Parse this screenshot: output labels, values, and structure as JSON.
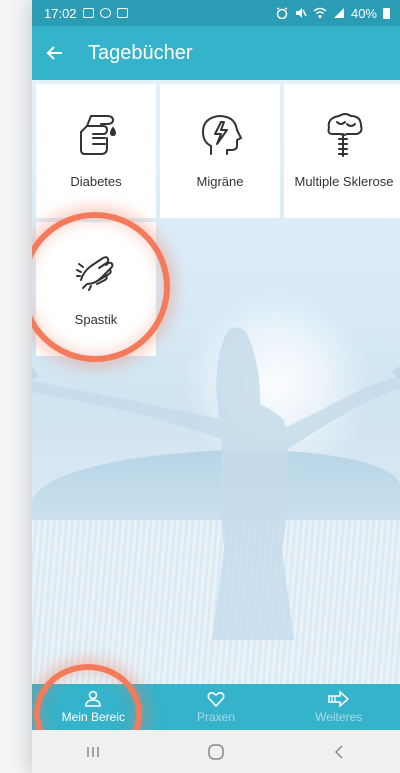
{
  "status_bar": {
    "time": "17:02",
    "battery": "40%"
  },
  "app_bar": {
    "title": "Tagebücher",
    "back_icon": "arrow-left-icon"
  },
  "tiles": [
    {
      "label": "Diabetes",
      "icon": "diabetes-hand-drop-icon"
    },
    {
      "label": "Migräne",
      "icon": "head-lightning-icon"
    },
    {
      "label": "Multiple Sklerose",
      "icon": "brain-spine-icon"
    },
    {
      "label": "Spastik",
      "icon": "spastic-hand-icon"
    }
  ],
  "bottom_nav": [
    {
      "label": "Mein Bereic",
      "icon": "person-icon",
      "active": true
    },
    {
      "label": "Praxen",
      "icon": "heart-icon",
      "active": false
    },
    {
      "label": "Weiteres",
      "icon": "arrow-right-outline-icon",
      "active": false
    }
  ],
  "system_nav": {
    "recents_icon": "recents-icon",
    "home_icon": "home-circle-icon",
    "back_icon": "chevron-left-icon"
  },
  "colors": {
    "primary": "#35b3ca",
    "status_bar": "#2a9cb4",
    "highlight_ring": "#f47a5c",
    "nav_inactive": "#a9dbe6"
  }
}
